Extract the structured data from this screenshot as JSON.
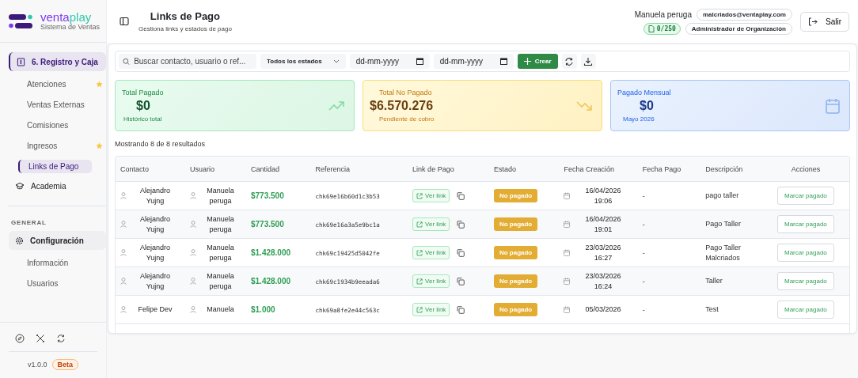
{
  "brand": {
    "name_part1": "venta",
    "name_part2": "play",
    "tagline": "Sistema de Ventas"
  },
  "sidebar": {
    "items": [
      {
        "label": "6. Registro y Caja",
        "selected": true,
        "children": [
          {
            "label": "Atenciones",
            "selected": false,
            "favorite": true
          },
          {
            "label": "Ventas Externas",
            "selected": false,
            "favorite": false
          },
          {
            "label": "Comisiones",
            "selected": false,
            "favorite": false
          },
          {
            "label": "Ingresos",
            "selected": false,
            "favorite": true
          },
          {
            "label": "Links de Pago",
            "selected": true,
            "favorite": false
          }
        ]
      },
      {
        "label": "Academia",
        "selected": false
      }
    ],
    "section_label": "GENERAL",
    "general_items": [
      {
        "label": "Configuración",
        "selected": false,
        "expanded": true,
        "children": [
          {
            "label": "Información",
            "selected": false
          },
          {
            "label": "Usuarios",
            "selected": false
          }
        ]
      }
    ],
    "version": "v1.0.0",
    "badge": "Beta"
  },
  "header": {
    "title": "Links de Pago",
    "subtitle": "Gestiona links y estados de pago",
    "user_name": "Manuela peruga",
    "email": "malcriados@ventaplay.com",
    "quota": "0/250",
    "role": "Administrador de Organización",
    "logout": "Salir"
  },
  "toolbar": {
    "search": {
      "placeholder": "Buscar contacto, usuario o ref..."
    },
    "status_filter": "Todos los estados",
    "date_from": {
      "placeholder": "dd-mm-yyyy"
    },
    "date_to": {
      "placeholder": "dd-mm-yyyy"
    },
    "create": "Crear"
  },
  "cards": [
    {
      "kind": "paid",
      "title": "Total Pagado",
      "value": "$0",
      "caption": "Histórico total"
    },
    {
      "kind": "unpaid",
      "title": "Total No Pagado",
      "value": "$6.570.276",
      "caption": "Pendiente de cobro"
    },
    {
      "kind": "monthly",
      "title": "Pagado Mensual",
      "value": "$0",
      "caption": "Mayo 2026"
    }
  ],
  "results": "Mostrando 8 de 8 resultados",
  "table": {
    "columns": [
      "Contacto",
      "Usuario",
      "Cantidad",
      "Referencia",
      "Link de Pago",
      "Estado",
      "Fecha Creación",
      "Fecha Pago",
      "Descripción",
      "Acciones"
    ],
    "rows": [
      {
        "contact": [
          "Alejandro",
          "Yujng"
        ],
        "user": [
          "Manuela",
          "peruga"
        ],
        "amount": "$773.500",
        "reference": "chk69e16b60d1c3b53",
        "link": "Ver link",
        "status": "No pagado",
        "paid": false,
        "created": [
          "16/04/2026",
          "19:06"
        ],
        "paid_date": "-",
        "description": [
          "pago taller"
        ],
        "action": "Marcar pagado"
      },
      {
        "contact": [
          "Alejandro",
          "Yujng"
        ],
        "user": [
          "Manuela",
          "peruga"
        ],
        "amount": "$773.500",
        "reference": "chk69e16a3a5e9bc1a",
        "link": "Ver link",
        "status": "No pagado",
        "paid": false,
        "created": [
          "16/04/2026",
          "19:01"
        ],
        "paid_date": "-",
        "description": [
          "Pago Taller"
        ],
        "action": "Marcar pagado"
      },
      {
        "contact": [
          "Alejandro",
          "Yujng"
        ],
        "user": [
          "Manuela",
          "peruga"
        ],
        "amount": "$1.428.000",
        "reference": "chk69c19425d5042fe",
        "link": "Ver link",
        "status": "No pagado",
        "paid": false,
        "created": [
          "23/03/2026",
          "16:27"
        ],
        "paid_date": "-",
        "description": [
          "Pago Taller",
          "Malcriados"
        ],
        "action": "Marcar pagado"
      },
      {
        "contact": [
          "Alejandro",
          "Yujng"
        ],
        "user": [
          "Manuela",
          "peruga"
        ],
        "amount": "$1.428.000",
        "reference": "chk69c1934b9eeada6",
        "link": "Ver link",
        "status": "No pagado",
        "paid": false,
        "created": [
          "23/03/2026",
          "16:24"
        ],
        "paid_date": "-",
        "description": [
          "Taller"
        ],
        "action": "Marcar pagado"
      },
      {
        "contact": [
          "Felipe Dev"
        ],
        "user": [
          "Manuela"
        ],
        "amount": "$1.000",
        "reference": "chk69a8fe2e44c563c",
        "link": "Ver link",
        "status": "No pagado",
        "paid": false,
        "created": [
          "05/03/2026"
        ],
        "paid_date": "-",
        "description": [
          "Test"
        ],
        "action": "Marcar pagado"
      }
    ]
  }
}
